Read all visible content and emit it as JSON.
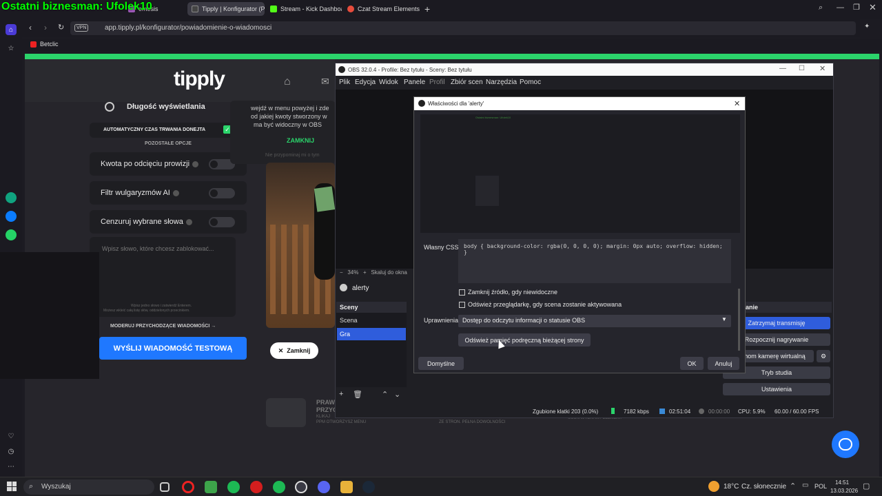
{
  "overlay_title": "Ostatni biznesman: Ufolek10",
  "browser": {
    "tabs": [
      {
        "label": "emesis",
        "color": "#9b59b6"
      },
      {
        "label": "Tipply | Konfigurator (Pow",
        "color": "#333333"
      },
      {
        "label": "Stream - Kick Dashboard",
        "color": "#53fc18"
      },
      {
        "label": "Czat Stream Elements nie",
        "color": "#e74c3c"
      }
    ],
    "vpn": "VPN",
    "url": "app.tipply.pl/konfigurator/powiadomienie-o-wiadomosci",
    "bookmark": "Betclic"
  },
  "tipply": {
    "logo": "tipply",
    "display_length": "Długość wyświetlania",
    "auto_duration": "AUTOMATYCZNY CZAS TRWANIA DONEJTA",
    "other_options": "POZOSTAŁE OPCJE",
    "option_commission": "Kwota po odcięciu prowizji",
    "option_ai_filter": "Filtr wulgaryzmów AI",
    "option_censor": "Cenzuruj wybrane słowa",
    "censor_placeholder": "Wpisz słowo, które chcesz zablokować...",
    "censor_hint1": "Wpisz jedno słowo i zatwierdź Enterem.",
    "censor_hint2": "Możesz wkleić całą listę słów, oddzielonych przecinkiem.",
    "moderate": "MODERUJ PRZYCHODZĄCE WIADOMOŚCI",
    "send_test": "WYŚLIJ WIADOMOŚĆ TESTOWĄ",
    "close_pill": "Zamknij",
    "popup_line1": "wejdź w menu powyżej i zde",
    "popup_line2": "od jakiej kwoty stworzony w",
    "popup_line3": "ma być widoczny w OBS",
    "popup_close": "ZAMKNIJ",
    "popup_remind": "Nie przypominaj mi o tym",
    "promo_title1": "PRAW",
    "promo_title2": "PRZYC",
    "promo_sub1": "KLIKAJ",
    "promo_sub2": "PPM OTWORZYSZ MENU",
    "promo_mid": "ZE STRON. PEŁNA DOWOLNOŚCI",
    "promo_right": "USUŃ WYBRANY ELEMENT"
  },
  "obs": {
    "title": "OBS 32.0.4 - Profile: Bez tytułu - Sceny: Bez tytułu",
    "menu": [
      "Plik",
      "Edycja",
      "Widok",
      "Panele",
      "Profil",
      "Zbiór scen",
      "Narzędzia",
      "Pomoc"
    ],
    "zoom": "34%",
    "zoom_label": "Skaluj do okna",
    "source_name": "alerty",
    "scenes_title": "Sceny",
    "scenes": [
      "Scena",
      "Gra"
    ],
    "active_scene": "Gra",
    "controls_title": "Sterowanie",
    "controls": [
      "Zatrzymaj transmisję",
      "Rozpocznij nagrywanie",
      "Uruchom kamerę wirtualną",
      "Tryb studia",
      "Ustawienia"
    ],
    "status": {
      "dropped": "Zgubione klatki 203 (0.0%)",
      "bitrate": "7182 kbps",
      "stream_time": "02:51:04",
      "rec_time": "00:00:00",
      "cpu": "CPU: 5.9%",
      "fps": "60.00 / 60.00 FPS"
    }
  },
  "dialog": {
    "title": "Właściwości dla 'alerty'",
    "preview_text": "Ostatni biznesman: Ufolek10",
    "css_label": "Własny CSS",
    "css_value": "body { background-color: rgba(0, 0, 0, 0); margin: 0px auto; overflow: hidden; }",
    "chk_shutdown": "Zamknij źródło, gdy niewidoczne",
    "chk_refresh": "Odśwież przeglądarkę, gdy scena zostanie aktywowana",
    "perm_label": "Uprawnienia",
    "perm_value": "Dostęp do odczytu informacji o statusie OBS",
    "refresh_cache": "Odśwież pamięć podręczną bieżącej strony",
    "defaults": "Domyślne",
    "ok": "OK",
    "cancel": "Anuluj"
  },
  "taskbar": {
    "search": "Wyszukaj",
    "weather_temp": "18°C",
    "weather_desc": "Cz. słonecznie",
    "lang": "POL",
    "time": "14:51",
    "date": "13.03.2026"
  }
}
